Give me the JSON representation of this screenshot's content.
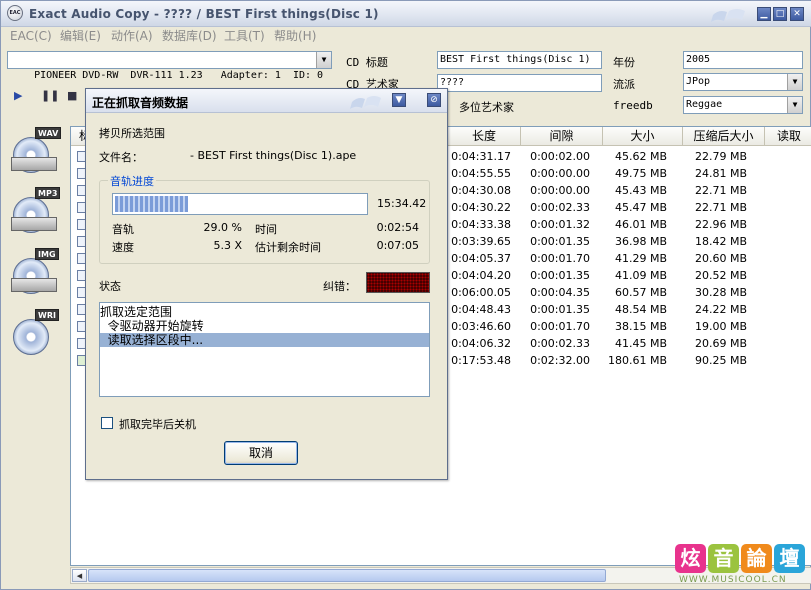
{
  "window": {
    "app_icon_label": "EAC",
    "title": "Exact Audio Copy   -   ???? / BEST First things(Disc 1)"
  },
  "menu": [
    "EAC(C)",
    "编辑(E)",
    "动作(A)",
    "数据库(D)",
    "工具(T)",
    "帮助(H)"
  ],
  "drive": {
    "selected": "PIONEER DVD-RW  DVR-111 1.23   Adapter: 1  ID: 0"
  },
  "cd_info": {
    "title_label": "CD 标题",
    "title_value": "BEST First things(Disc 1)",
    "artist_label": "CD 艺术家",
    "artist_value": "????",
    "year_label": "年份",
    "year_value": "2005",
    "genre_label": "流派",
    "genre_value": "JPop",
    "multi_artist_label": "多位艺术家",
    "freedb_label": "freedb",
    "freedb_value": "Reggae"
  },
  "side_toolbar": [
    {
      "tag": "WAV",
      "icon": "copy-wav-icon"
    },
    {
      "tag": "MP3",
      "icon": "copy-compressed-icon"
    },
    {
      "tag": "IMG",
      "icon": "copy-image-icon"
    },
    {
      "tag": "WRI",
      "icon": "write-cd-icon"
    }
  ],
  "track_list": {
    "first_col_partial": "标",
    "columns": [
      "长度",
      "间隙",
      "大小",
      "压缩后大小",
      "读取"
    ],
    "rows": [
      {
        "length": "0:04:31.17",
        "gap": "0:00:02.00",
        "size": "45.62 MB",
        "compressed": "22.79 MB"
      },
      {
        "length": "0:04:55.55",
        "gap": "0:00:00.00",
        "size": "49.75 MB",
        "compressed": "24.81 MB"
      },
      {
        "length": "0:04:30.08",
        "gap": "0:00:00.00",
        "size": "45.43 MB",
        "compressed": "22.71 MB"
      },
      {
        "length": "0:04:30.22",
        "gap": "0:00:02.33",
        "size": "45.47 MB",
        "compressed": "22.71 MB"
      },
      {
        "length": "0:04:33.38",
        "gap": "0:00:01.32",
        "size": "46.01 MB",
        "compressed": "22.96 MB"
      },
      {
        "length": "0:03:39.65",
        "gap": "0:00:01.35",
        "size": "36.98 MB",
        "compressed": "18.42 MB"
      },
      {
        "length": "0:04:05.37",
        "gap": "0:00:01.70",
        "size": "41.29 MB",
        "compressed": "20.60 MB"
      },
      {
        "length": "0:04:04.20",
        "gap": "0:00:01.35",
        "size": "41.09 MB",
        "compressed": "20.52 MB"
      },
      {
        "length": "0:06:00.05",
        "gap": "0:00:04.35",
        "size": "60.57 MB",
        "compressed": "30.28 MB"
      },
      {
        "length": "0:04:48.43",
        "gap": "0:00:01.35",
        "size": "48.54 MB",
        "compressed": "24.22 MB"
      },
      {
        "length": "0:03:46.60",
        "gap": "0:00:01.70",
        "size": "38.15 MB",
        "compressed": "19.00 MB"
      },
      {
        "length": "0:04:06.32",
        "gap": "0:00:02.33",
        "size": "41.45 MB",
        "compressed": "20.69 MB"
      },
      {
        "length": "0:17:53.48",
        "gap": "0:02:32.00",
        "size": "180.61 MB",
        "compressed": "90.25 MB"
      }
    ]
  },
  "dialog": {
    "title": "正在抓取音频数据",
    "copy_selection": "拷贝所选范围",
    "filename_label": "文件名：",
    "filename_value": "- BEST First things(Disc 1).ape",
    "track_progress_label": "音轨进度",
    "progress_fraction": 0.29,
    "elapsed": "15:34.42",
    "track_label": "音轨",
    "track_percent": "29.0 %",
    "time_label": "时间",
    "time_value": "0:02:54",
    "speed_label": "速度",
    "speed_value": "5.3 X",
    "remaining_label": "估计剩余时间",
    "remaining_value": "0:07:05",
    "status_label": "状态",
    "error_label": "纠错：",
    "log": [
      "抓取选定范围",
      "  令驱动器开始旋转",
      "  读取选择区段中..."
    ],
    "shutdown_label": "抓取完毕后关机",
    "cancel_label": "取消"
  },
  "watermark": {
    "chars": [
      "炫",
      "音",
      "論",
      "壇"
    ],
    "colors": [
      "#e8338d",
      "#9bc33f",
      "#f08a1c",
      "#2aa5d9"
    ],
    "url": "WWW.MUSICOOL.CN"
  }
}
